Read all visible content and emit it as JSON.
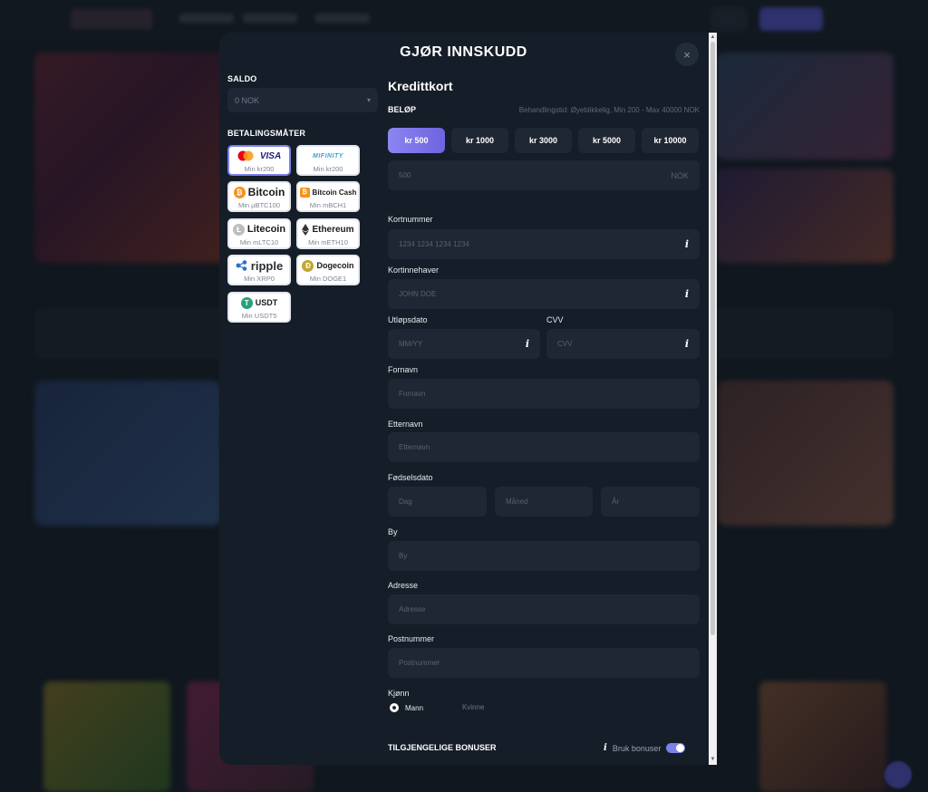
{
  "modal": {
    "title": "GJØR INNSKUDD",
    "close_icon": "×"
  },
  "balance": {
    "label": "SALDO",
    "value": "0 NOK"
  },
  "payment_methods": {
    "label": "BETALINGSMÅTER",
    "items": [
      {
        "name": "VISA",
        "min": "Min kr200",
        "icon": "mastercard-visa-icon"
      },
      {
        "name": "MIFINITY",
        "min": "Min kr200",
        "icon": "mifinity-icon"
      },
      {
        "name": "Bitcoin",
        "min": "Min µBTC100",
        "icon": "bitcoin-icon"
      },
      {
        "name": "Bitcoin Cash",
        "min": "Min mBCH1",
        "icon": "bitcoin-cash-icon"
      },
      {
        "name": "Litecoin",
        "min": "Min mLTC10",
        "icon": "litecoin-icon"
      },
      {
        "name": "Ethereum",
        "min": "Min mETH10",
        "icon": "ethereum-icon"
      },
      {
        "name": "ripple",
        "min": "Min XRP0",
        "icon": "ripple-icon"
      },
      {
        "name": "Dogecoin",
        "min": "Min DOGE1",
        "icon": "dogecoin-icon"
      },
      {
        "name": "USDT",
        "min": "Min USDT5",
        "icon": "tether-icon"
      }
    ]
  },
  "form": {
    "title": "Kredittkort",
    "amount_label": "BELØP",
    "amount_info": "Behandlingstid: Øyeblikkelig, Min 200 - Max 40000 NOK",
    "chips": [
      "kr 500",
      "kr 1000",
      "kr 3000",
      "kr 5000",
      "kr 10000"
    ],
    "amount_value": "500",
    "currency": "NOK",
    "card_number": {
      "label": "Kortnummer",
      "placeholder": "1234 1234 1234 1234"
    },
    "card_holder": {
      "label": "Kortinnehaver",
      "placeholder": "JOHN DOE"
    },
    "expiry": {
      "label": "Utløpsdato",
      "placeholder": "MM/YY"
    },
    "cvv": {
      "label": "CVV",
      "placeholder": "CVV"
    },
    "first_name": {
      "label": "Fornavn",
      "placeholder": "Fornavn"
    },
    "last_name": {
      "label": "Etternavn",
      "placeholder": "Etternavn"
    },
    "birth_date": {
      "label": "Fødselsdato",
      "day": "Dag",
      "month": "Måned",
      "year": "År"
    },
    "city": {
      "label": "By",
      "placeholder": "By"
    },
    "address": {
      "label": "Adresse",
      "placeholder": "Adresse"
    },
    "postcode": {
      "label": "Postnummer",
      "placeholder": "Postnummer"
    },
    "gender": {
      "label": "Kjønn",
      "male": "Mann",
      "female": "Kvinne"
    },
    "bonuses_label": "TILGJENGELIGE BONUSER",
    "use_bonuses_label": "Bruk bonuser",
    "info_icon": "i"
  },
  "colors": {
    "accent": "#7c80e8",
    "modal_bg": "#151d28",
    "field_bg": "#1e2733"
  }
}
